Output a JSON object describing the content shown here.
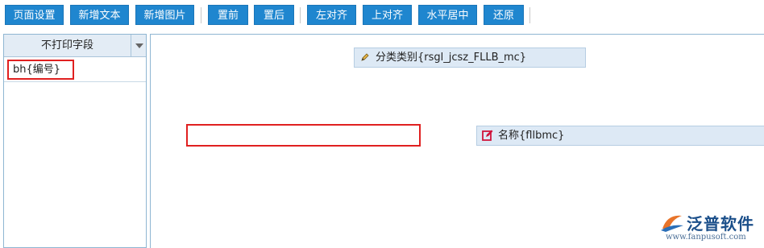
{
  "toolbar": {
    "page_setup": "页面设置",
    "add_text": "新增文本",
    "add_image": "新增图片",
    "bring_front": "置前",
    "send_back": "置后",
    "align_left": "左对齐",
    "align_top": "上对齐",
    "center_horizontal": "水平居中",
    "restore": "还原"
  },
  "left_panel": {
    "title": "不打印字段",
    "items": [
      {
        "label": "bh{编号}"
      }
    ]
  },
  "canvas": {
    "fields": [
      {
        "label": "分类类别{rsgl_jcsz_FLLB_mc}",
        "icon": "pencil-icon"
      },
      {
        "label": "名称{fllbmc}",
        "icon": "edit-icon"
      }
    ]
  },
  "watermark": {
    "brand": "泛普软件",
    "url": "www.fanpusoft.com"
  },
  "colors": {
    "button_bg": "#1f86cf",
    "highlight_border": "#e02020",
    "field_bg": "#dde9f5",
    "edit_icon": "#d0143c"
  }
}
